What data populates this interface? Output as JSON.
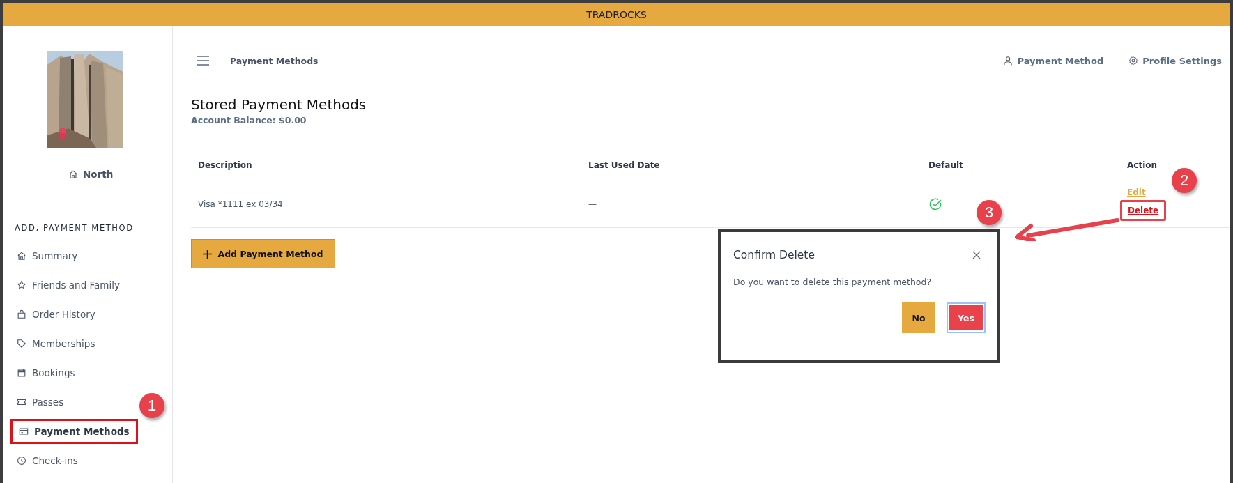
{
  "app_bar": {
    "title": "TRADROCKS"
  },
  "sidebar": {
    "location": "North",
    "section_heading": "ADD, PAYMENT METHOD",
    "items": [
      {
        "label": "Summary",
        "selected": false
      },
      {
        "label": "Friends and Family",
        "selected": false
      },
      {
        "label": "Order History",
        "selected": false
      },
      {
        "label": "Memberships",
        "selected": false
      },
      {
        "label": "Bookings",
        "selected": false
      },
      {
        "label": "Passes",
        "selected": false
      },
      {
        "label": "Payment Methods",
        "selected": true
      },
      {
        "label": "Check-ins",
        "selected": false
      }
    ]
  },
  "header": {
    "page_title": "Payment Methods",
    "links": [
      "Payment Method",
      "Profile Settings"
    ]
  },
  "content": {
    "title": "Stored Payment Methods",
    "balance": "Account Balance: $0.00",
    "table": {
      "columns": [
        "Description",
        "Last Used Date",
        "Default",
        "Action"
      ],
      "rows": [
        {
          "description": "Visa *1111 ex 03/34",
          "last_used": "—",
          "default": true,
          "actions": [
            "Edit",
            "Delete"
          ]
        }
      ]
    },
    "add_button": "Add Payment Method"
  },
  "dialog": {
    "title": "Confirm Delete",
    "message": "Do you want to delete this payment method?",
    "buttons": [
      {
        "label": "No",
        "kind": "secondary",
        "focused": false
      },
      {
        "label": "Yes",
        "kind": "danger",
        "focused": true
      }
    ]
  },
  "annotations": {
    "callouts": [
      "1",
      "2",
      "3"
    ]
  }
}
